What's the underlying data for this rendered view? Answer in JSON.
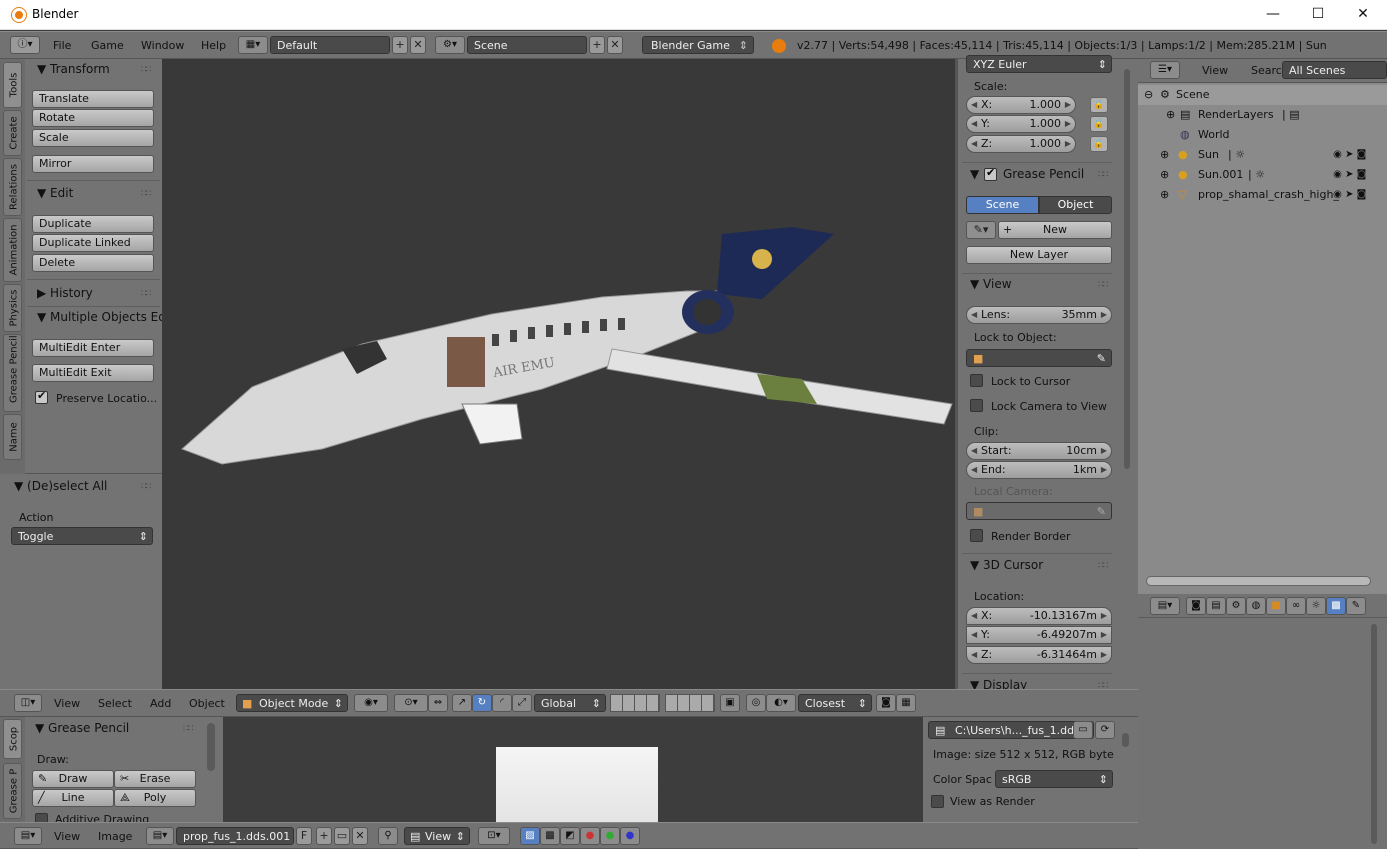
{
  "window": {
    "title": "Blender",
    "minimize": "—",
    "maximize": "☐",
    "close": "✕"
  },
  "info_header": {
    "menus": [
      "File",
      "Game",
      "Window",
      "Help"
    ],
    "screen_layout": "Default",
    "scene": "Scene",
    "engine": "Blender Game",
    "stats": "v2.77 | Verts:54,498 | Faces:45,114 | Tris:45,114 | Objects:1/3 | Lamps:1/2 | Mem:285.21M | Sun"
  },
  "tool_tabs": [
    "Tools",
    "Create",
    "Relations",
    "Animation",
    "Physics",
    "Grease Pencil",
    "Name"
  ],
  "tool_shelf": {
    "transform": {
      "title": "Transform",
      "buttons": [
        "Translate",
        "Rotate",
        "Scale",
        "Mirror"
      ]
    },
    "edit": {
      "title": "Edit",
      "buttons": [
        "Duplicate",
        "Duplicate Linked",
        "Delete"
      ]
    },
    "history": {
      "title": "History"
    },
    "multi": {
      "title": "Multiple Objects Edit",
      "buttons": [
        "MultiEdit Enter",
        "MultiEdit Exit"
      ],
      "preserve": "Preserve Locatio..."
    },
    "operator": {
      "title": "(De)select All",
      "action_label": "Action",
      "action_value": "Toggle"
    }
  },
  "properties": {
    "rotation_mode": "XYZ Euler",
    "scale_label": "Scale:",
    "scale": [
      {
        "axis": "X:",
        "value": "1.000"
      },
      {
        "axis": "Y:",
        "value": "1.000"
      },
      {
        "axis": "Z:",
        "value": "1.000"
      }
    ],
    "grease": {
      "title": "Grease Pencil",
      "scene_tab": "Scene",
      "object_tab": "Object",
      "new": "New",
      "new_layer": "New Layer"
    },
    "view": {
      "title": "View",
      "lens_label": "Lens:",
      "lens_value": "35mm",
      "lock_obj": "Lock to Object:",
      "lock_cursor": "Lock to Cursor",
      "lock_cam": "Lock Camera to View",
      "clip": "Clip:",
      "start_label": "Start:",
      "start_value": "10cm",
      "end_label": "End:",
      "end_value": "1km",
      "local_cam": "Local Camera:",
      "render_border": "Render Border"
    },
    "cursor": {
      "title": "3D Cursor",
      "location": "Location:",
      "x_label": "X:",
      "x_value": "-10.13167m",
      "y_label": "Y:",
      "y_value": "-6.49207m",
      "z_label": "Z:",
      "z_value": "-6.31464m"
    },
    "display": "Display"
  },
  "outliner": {
    "menus": [
      "View",
      "Search"
    ],
    "filter": "All Scenes",
    "items": [
      "Scene",
      "RenderLayers",
      "World",
      "Sun",
      "Sun.001",
      "prop_shamal_crash_high_"
    ]
  },
  "view3d_header": {
    "menus": [
      "View",
      "Select",
      "Add",
      "Object"
    ],
    "mode": "Object Mode",
    "orientation": "Global",
    "snap": "Closest"
  },
  "bottom_left": {
    "tabs": [
      "Scop",
      "Grease P"
    ],
    "title": "Grease Pencil",
    "draw_label": "Draw:",
    "tools": [
      "Draw",
      "Erase",
      "Line",
      "Poly"
    ],
    "additive": "Additive Drawing"
  },
  "image_props": {
    "path": "C:\\Users\\h..._fus_1.dds",
    "info": "Image: size 512 x 512, RGB byte",
    "color_space_label": "Color Spac",
    "color_space": "sRGB",
    "view_as_render": "View as Render"
  },
  "image_header": {
    "menus": [
      "View",
      "Image"
    ],
    "image_name": "prop_fus_1.dds.001",
    "fake_user": "F",
    "view": "View"
  },
  "viewport": {
    "airplane_livery": "AIR EMU"
  },
  "colors": {
    "accent_blue": "#5680c2",
    "viewport_bg": "#393939",
    "panel_bg": "#737373"
  }
}
